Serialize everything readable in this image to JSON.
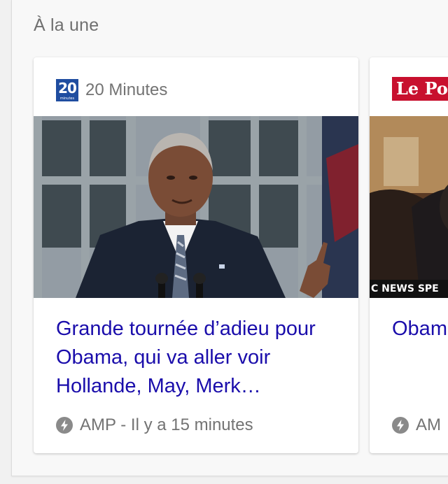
{
  "section": {
    "title": "À la une"
  },
  "cards": [
    {
      "source": {
        "logo_text": "20",
        "logo_subtext": "minutes",
        "name": "20 Minutes",
        "logo_color": "#1f4da0"
      },
      "headline": "Grande tournée d’adieu pour Obama, qui va aller voir Hollande, May, Merk…",
      "meta": "AMP - Il y a 15 minutes",
      "icon": "amp-lightning-icon"
    },
    {
      "source": {
        "logo_text": "Le Po",
        "logo_color": "#c8102e"
      },
      "image_caption": "C NEWS SPE",
      "headline": "Obam renco",
      "meta": "AM",
      "icon": "amp-lightning-icon"
    }
  ],
  "colors": {
    "headline": "#1a0dab",
    "muted_text": "#737373",
    "section_title": "#707070"
  }
}
